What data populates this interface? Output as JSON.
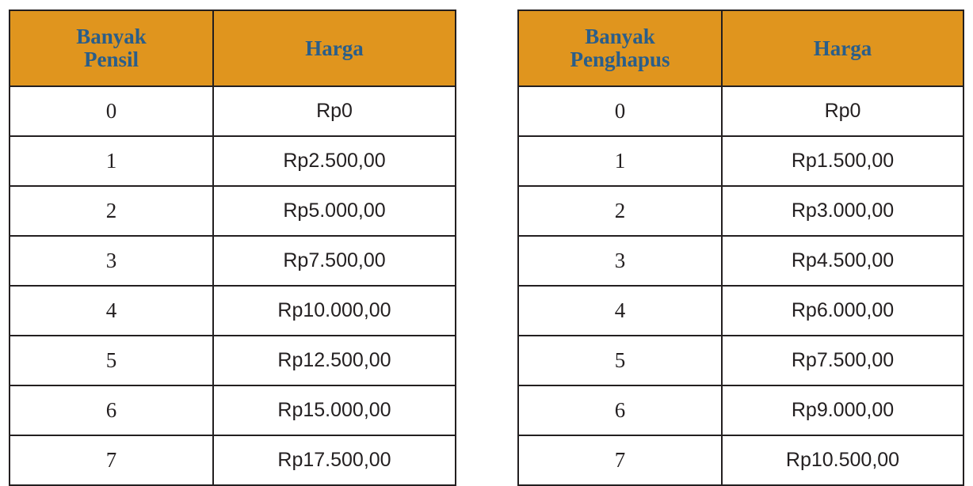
{
  "tables": [
    {
      "header": {
        "quantity_line1": "Banyak",
        "quantity_line2": "Pensil",
        "price": "Harga"
      },
      "rows": [
        {
          "qty": "0",
          "price": "Rp0"
        },
        {
          "qty": "1",
          "price": "Rp2.500,00"
        },
        {
          "qty": "2",
          "price": "Rp5.000,00"
        },
        {
          "qty": "3",
          "price": "Rp7.500,00"
        },
        {
          "qty": "4",
          "price": "Rp10.000,00"
        },
        {
          "qty": "5",
          "price": "Rp12.500,00"
        },
        {
          "qty": "6",
          "price": "Rp15.000,00"
        },
        {
          "qty": "7",
          "price": "Rp17.500,00"
        }
      ]
    },
    {
      "header": {
        "quantity_line1": "Banyak",
        "quantity_line2": "Penghapus",
        "price": "Harga"
      },
      "rows": [
        {
          "qty": "0",
          "price": "Rp0"
        },
        {
          "qty": "1",
          "price": "Rp1.500,00"
        },
        {
          "qty": "2",
          "price": "Rp3.000,00"
        },
        {
          "qty": "3",
          "price": "Rp4.500,00"
        },
        {
          "qty": "4",
          "price": "Rp6.000,00"
        },
        {
          "qty": "5",
          "price": "Rp7.500,00"
        },
        {
          "qty": "6",
          "price": "Rp9.000,00"
        },
        {
          "qty": "7",
          "price": "Rp10.500,00"
        }
      ]
    }
  ],
  "colors": {
    "header_background": "#e0951e",
    "header_text": "#2a5e8a",
    "border": "#231f20",
    "cell_text": "#231f20"
  }
}
